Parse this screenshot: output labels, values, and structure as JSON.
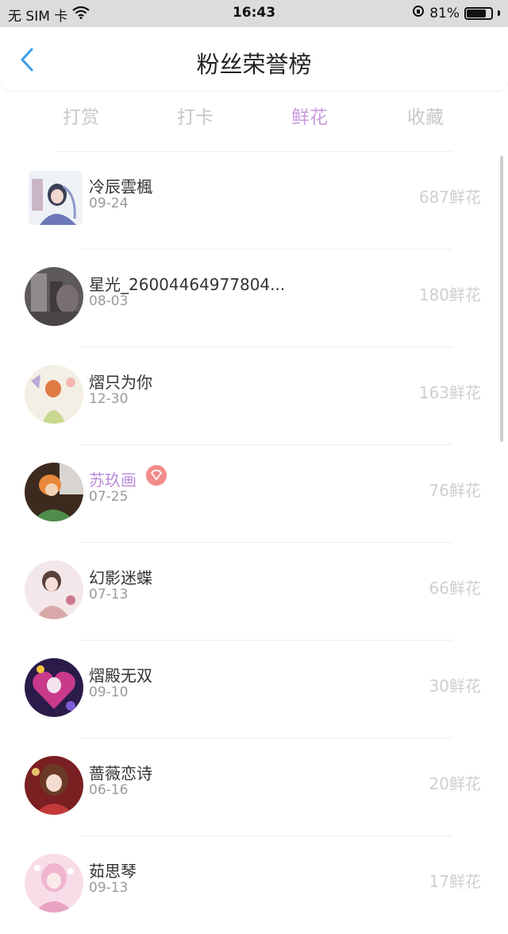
{
  "status_bar": {
    "carrier": "无 SIM 卡",
    "time": "16:43",
    "battery": "81%",
    "battery_level": 0.81
  },
  "header": {
    "title": "粉丝荣誉榜"
  },
  "tabs": [
    {
      "label": "打赏",
      "active": false
    },
    {
      "label": "打卡",
      "active": false
    },
    {
      "label": "鲜花",
      "active": true
    },
    {
      "label": "收藏",
      "active": false
    }
  ],
  "fans": [
    {
      "name": "冷辰雲楓",
      "date": "09-24",
      "count": "687鲜花"
    },
    {
      "name": "星光_26004464977804...",
      "date": "08-03",
      "count": "180鲜花"
    },
    {
      "name": "熠只为你",
      "date": "12-30",
      "count": "163鲜花"
    },
    {
      "name": "苏玖画",
      "date": "07-25",
      "count": "76鲜花"
    },
    {
      "name": "幻影迷蝶",
      "date": "07-13",
      "count": "66鲜花"
    },
    {
      "name": "熠殿无双",
      "date": "09-10",
      "count": "30鲜花"
    },
    {
      "name": "蔷薇恋诗",
      "date": "06-16",
      "count": "20鲜花"
    },
    {
      "name": "茹思琴",
      "date": "09-13",
      "count": "17鲜花"
    }
  ],
  "colors": {
    "accent": "#c99be0",
    "back_arrow": "#3a9be6",
    "badge": "#f38b8b"
  }
}
